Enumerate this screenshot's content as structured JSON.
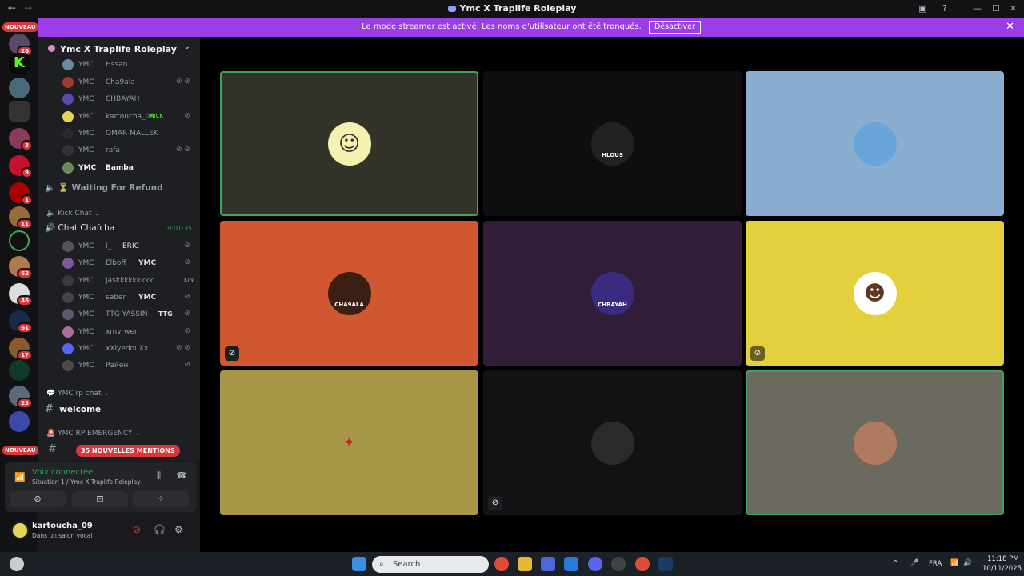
{
  "window": {
    "title": "Ymc X Traplife Roleplay"
  },
  "banner": {
    "text": "Le mode streamer est activé. Les noms d'utilisateur ont été tronqués.",
    "button": "Désactiver"
  },
  "servers": {
    "new_label": "NOUVEAU",
    "badges": [
      "28",
      "3",
      "9",
      "1",
      "11",
      "62",
      "46",
      "61",
      "17",
      "23"
    ]
  },
  "guild": {
    "name": "Ymc X Traplife Roleplay"
  },
  "members_top": [
    {
      "tag": "YMC",
      "name": "Hssan"
    },
    {
      "tag": "YMC",
      "name": "Cha9ala"
    },
    {
      "tag": "YMC",
      "name": "CHBAYAH"
    },
    {
      "tag": "YMC",
      "name": "kartoucha_09",
      "extra": "KICK"
    },
    {
      "tag": "YMC",
      "name": "OMAR MALLEK"
    },
    {
      "tag": "YMC",
      "name": "rafa"
    },
    {
      "tag": "YMC",
      "name": "Bamba"
    }
  ],
  "channels": {
    "waiting": "Waiting For Refund",
    "kick_cat": "Kick Chat",
    "chat_chafcha": "Chat Chafcha",
    "timer": "9:01:35",
    "rp_cat": "YMC rp chat",
    "welcome": "welcome",
    "emergency_cat": "YMC RP EMERGENCY",
    "mentions": "35 NOUVELLES MENTIONS"
  },
  "members_kick": [
    {
      "tag": "YMC",
      "name": "l_",
      "extra": "ERIC"
    },
    {
      "tag": "YMC",
      "name": "Elboff",
      "extra": "YMC"
    },
    {
      "tag": "YMC",
      "name": "Jaskkkkkkkkk",
      "extra": "KIN"
    },
    {
      "tag": "YMC",
      "name": "saber",
      "extra": "YMC"
    },
    {
      "tag": "YMC",
      "name": "TTG YASSIN",
      "extra": "TTG"
    },
    {
      "tag": "YMC",
      "name": "xmvrwen"
    },
    {
      "tag": "YMC",
      "name": "xXlyedouXx"
    },
    {
      "tag": "YMC",
      "name": "Райен"
    }
  ],
  "voice": {
    "status": "Voix connectée",
    "location": "Situation 1 / Ymc X Traplife Roleplay"
  },
  "user": {
    "name": "kartoucha_09",
    "status": "Dans un salon vocal"
  },
  "tiles": [
    {
      "bg": "#34332a",
      "avatar_bg": "#f7f1b0",
      "glyph": "☺",
      "speaking": true,
      "muted": false
    },
    {
      "bg": "#0e0e10",
      "avatar_bg": "#222",
      "glyph": "",
      "label": "HLOUS",
      "speaking": false,
      "muted": false
    },
    {
      "bg": "#8aaed0",
      "avatar_bg": "#6aa5d9",
      "glyph": "",
      "speaking": false,
      "muted": false
    },
    {
      "bg": "#d0572f",
      "avatar_bg": "#3b1e14",
      "glyph": "",
      "label": "CHA9ALA",
      "speaking": false,
      "muted": true
    },
    {
      "bg": "#311d38",
      "avatar_bg": "#3a2a80",
      "glyph": "",
      "label": "CHBAYAH",
      "speaking": false,
      "muted": false
    },
    {
      "bg": "#e4cf3c",
      "avatar_bg": "#ffffff",
      "glyph": "☻",
      "speaking": false,
      "muted": true
    },
    {
      "bg": "#a79548",
      "avatar_bg": "transparent",
      "glyph": "✦",
      "speaking": false,
      "muted": false
    },
    {
      "bg": "#121214",
      "avatar_bg": "#2a2a2a",
      "glyph": "",
      "speaking": false,
      "muted": true
    },
    {
      "bg": "#6b6960",
      "avatar_bg": "#b07a60",
      "glyph": "",
      "speaking": true,
      "muted": false
    }
  ],
  "taskbar": {
    "search": "Search",
    "lang": "FRA",
    "time": "11:18 PM",
    "date": "10/11/2025"
  }
}
